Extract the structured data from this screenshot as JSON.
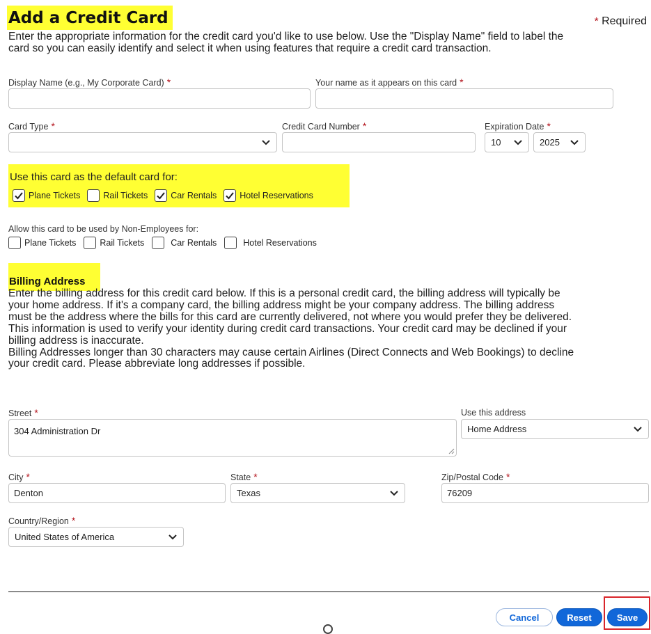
{
  "header": {
    "title": "Add a Credit Card",
    "required_star": "*",
    "required_label": "Required"
  },
  "intro": {
    "lines": [
      "Enter the appropriate information for the credit card you'd like to use below. Use the \"Display Name\" field to label the",
      "card so you can easily identify and select it when using features that require a credit card transaction."
    ]
  },
  "card": {
    "display_name_label": "Display Name (e.g., My Corporate Card)",
    "display_name_value": "",
    "name_on_card_label": "Your name as it appears on this card",
    "name_on_card_value": "",
    "card_type_label": "Card Type",
    "card_type_value": "",
    "card_number_label": "Credit Card Number",
    "card_number_value": "",
    "expiration_label": "Expiration Date",
    "expiration_month": "10",
    "expiration_year": "2025"
  },
  "default_card": {
    "heading": "Use this card as the default card for:",
    "options": [
      {
        "label": "Plane Tickets",
        "checked": true
      },
      {
        "label": "Rail Tickets",
        "checked": false
      },
      {
        "label": "Car Rentals",
        "checked": true
      },
      {
        "label": "Hotel Reservations",
        "checked": true
      }
    ]
  },
  "non_employees": {
    "heading": "Allow this card to be used by Non-Employees for:",
    "options": [
      {
        "label": "Plane Tickets",
        "checked": false
      },
      {
        "label": "Rail Tickets",
        "checked": false
      },
      {
        "label": "Car Rentals",
        "checked": false
      },
      {
        "label": "Hotel Reservations",
        "checked": false
      }
    ]
  },
  "billing": {
    "heading": "Billing Address",
    "lines": [
      "Enter the billing address for this credit card below. If this is a personal credit card, the billing address will typically be",
      "your home address. If it's a company card, the billing address might be your company address. The billing address",
      "must be the address where the bills for this card are currently delivered, not where you would prefer they be delivered.",
      "This information is used to verify your identity during credit card transactions. Your credit card may be declined if your",
      "billing address is inaccurate.",
      "Billing Addresses longer than 30 characters may cause certain Airlines (Direct Connects and Web Bookings) to decline",
      "your credit card. Please abbreviate long addresses if possible."
    ],
    "street_label": "Street",
    "street_value": "304 Administration Dr",
    "use_address_label": "Use this address",
    "use_address_value": "Home Address",
    "city_label": "City",
    "city_value": "Denton",
    "state_label": "State",
    "state_value": "Texas",
    "zip_label": "Zip/Postal Code",
    "zip_value": "76209",
    "country_label": "Country/Region",
    "country_value": "United States of America"
  },
  "actions": {
    "cancel_label": "Cancel",
    "reset_label": "Reset",
    "save_label": "Save"
  },
  "colors": {
    "highlight": "#ffff33",
    "required_star": "#b3121b",
    "primary_button": "#1167d9",
    "save_outline": "#d9252a"
  }
}
